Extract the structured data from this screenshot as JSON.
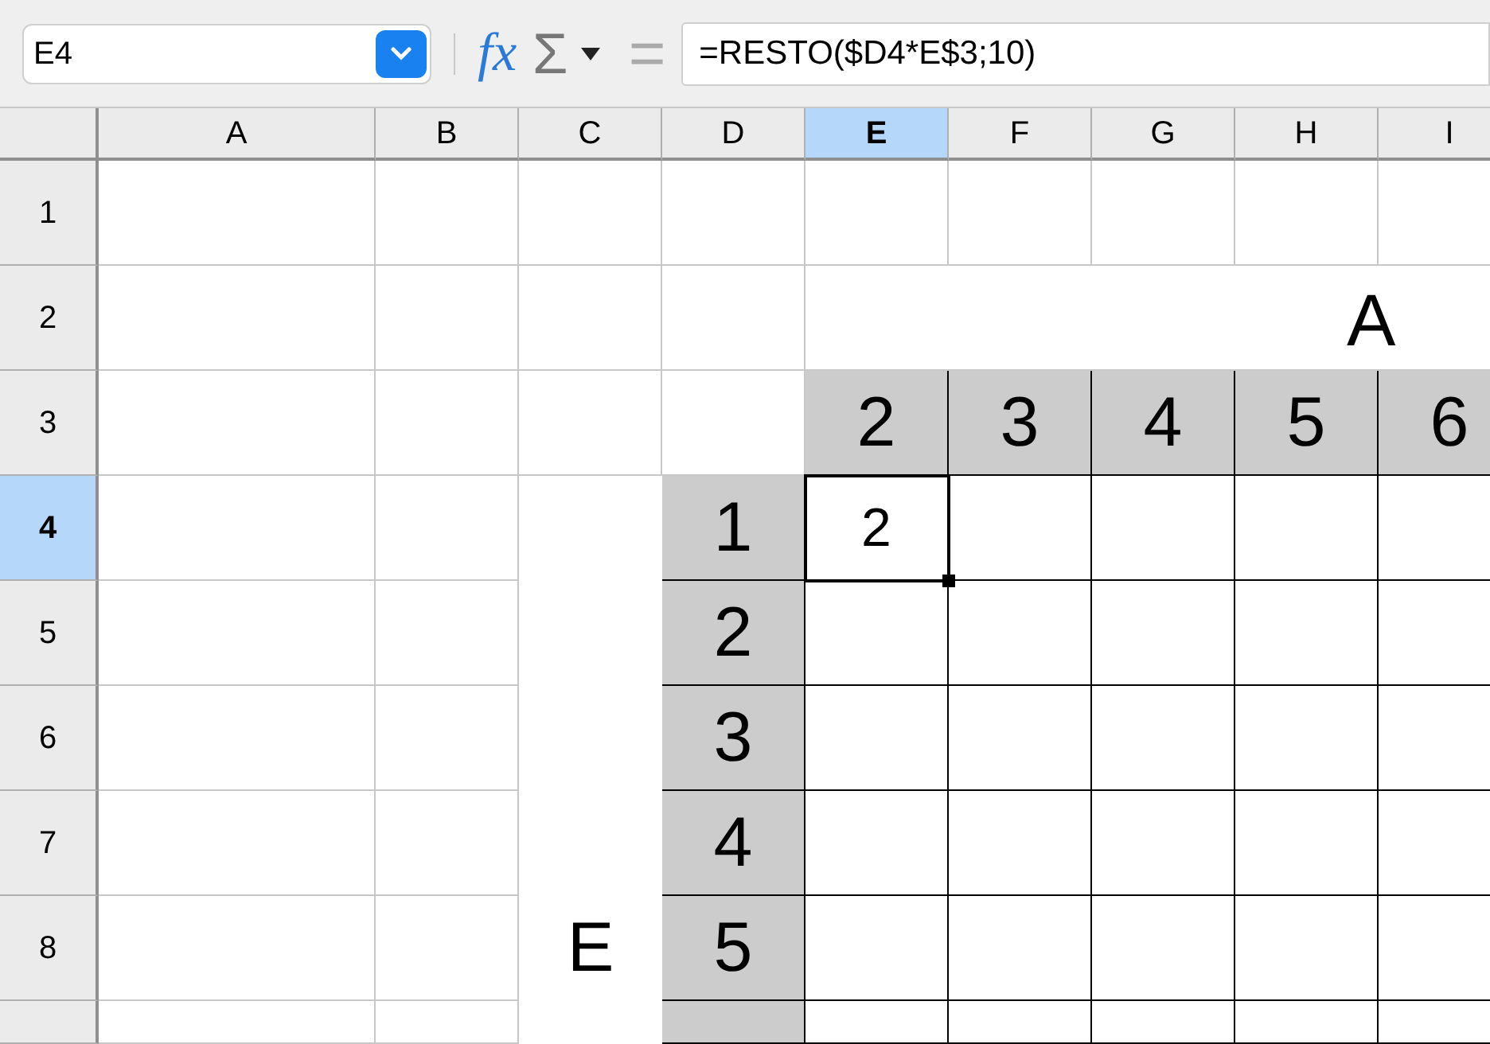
{
  "toolbar": {
    "name_box": "E4",
    "function_wizard": "fx",
    "sum": "Σ",
    "equals": "=",
    "formula": "=RESTO($D4*E$3;10)"
  },
  "columns": [
    {
      "label": "A",
      "selected": false
    },
    {
      "label": "B",
      "selected": false
    },
    {
      "label": "C",
      "selected": false
    },
    {
      "label": "D",
      "selected": false
    },
    {
      "label": "E",
      "selected": true
    },
    {
      "label": "F",
      "selected": false
    },
    {
      "label": "G",
      "selected": false
    },
    {
      "label": "H",
      "selected": false
    },
    {
      "label": "I",
      "selected": false
    }
  ],
  "rows": [
    {
      "label": "1",
      "selected": false,
      "cells": [
        {
          "kind": "grid"
        },
        {
          "kind": "grid"
        },
        {
          "kind": "grid"
        },
        {
          "kind": "grid"
        },
        {
          "kind": "grid"
        },
        {
          "kind": "grid"
        },
        {
          "kind": "grid"
        },
        {
          "kind": "grid"
        },
        {
          "kind": "grid"
        }
      ]
    },
    {
      "label": "2",
      "selected": false,
      "cells": [
        {
          "kind": "grid"
        },
        {
          "kind": "grid"
        },
        {
          "kind": "grid"
        },
        {
          "kind": "grid"
        },
        {
          "kind": "title",
          "text": "A"
        }
      ]
    },
    {
      "label": "3",
      "selected": false,
      "cells": [
        {
          "kind": "grid"
        },
        {
          "kind": "grid"
        },
        {
          "kind": "grid"
        },
        {
          "kind": "grid"
        },
        {
          "kind": "header",
          "text": "2"
        },
        {
          "kind": "header",
          "text": "3"
        },
        {
          "kind": "header",
          "text": "4"
        },
        {
          "kind": "header",
          "text": "5"
        },
        {
          "kind": "header",
          "text": "6"
        }
      ]
    },
    {
      "label": "4",
      "selected": true,
      "cells": [
        {
          "kind": "grid"
        },
        {
          "kind": "grid"
        },
        {
          "kind": "blank"
        },
        {
          "kind": "header",
          "text": "1"
        },
        {
          "kind": "table",
          "text": "2",
          "selected": true
        },
        {
          "kind": "table",
          "selected": false
        },
        {
          "kind": "table",
          "selected": false
        },
        {
          "kind": "table",
          "selected": false
        },
        {
          "kind": "table",
          "selected": false
        }
      ]
    },
    {
      "label": "5",
      "selected": false,
      "cells": [
        {
          "kind": "grid"
        },
        {
          "kind": "grid"
        },
        {
          "kind": "blank"
        },
        {
          "kind": "header",
          "text": "2"
        },
        {
          "kind": "table",
          "selected": false
        },
        {
          "kind": "table",
          "selected": false
        },
        {
          "kind": "table",
          "selected": false
        },
        {
          "kind": "table",
          "selected": false
        },
        {
          "kind": "table",
          "selected": false
        }
      ]
    },
    {
      "label": "6",
      "selected": false,
      "cells": [
        {
          "kind": "grid"
        },
        {
          "kind": "grid"
        },
        {
          "kind": "blank"
        },
        {
          "kind": "header",
          "text": "3"
        },
        {
          "kind": "table",
          "selected": false
        },
        {
          "kind": "table",
          "selected": false
        },
        {
          "kind": "table",
          "selected": false
        },
        {
          "kind": "table",
          "selected": false
        },
        {
          "kind": "table",
          "selected": false
        }
      ]
    },
    {
      "label": "7",
      "selected": false,
      "cells": [
        {
          "kind": "grid"
        },
        {
          "kind": "grid"
        },
        {
          "kind": "blank"
        },
        {
          "kind": "header",
          "text": "4"
        },
        {
          "kind": "table",
          "selected": false
        },
        {
          "kind": "table",
          "selected": false
        },
        {
          "kind": "table",
          "selected": false
        },
        {
          "kind": "table",
          "selected": false
        },
        {
          "kind": "table",
          "selected": false
        }
      ]
    },
    {
      "label": "8",
      "selected": false,
      "cells": [
        {
          "kind": "grid"
        },
        {
          "kind": "grid"
        },
        {
          "kind": "blank",
          "text": "E"
        },
        {
          "kind": "header",
          "text": "5"
        },
        {
          "kind": "table",
          "selected": false
        },
        {
          "kind": "table",
          "selected": false
        },
        {
          "kind": "table",
          "selected": false
        },
        {
          "kind": "table",
          "selected": false
        },
        {
          "kind": "table",
          "selected": false
        }
      ]
    },
    {
      "selected": false,
      "cells": [
        {
          "kind": "grid"
        },
        {
          "kind": "grid"
        },
        {
          "kind": "blank"
        },
        {
          "kind": "header"
        },
        {
          "kind": "table",
          "selected": false
        },
        {
          "kind": "table",
          "selected": false
        },
        {
          "kind": "table",
          "selected": false
        },
        {
          "kind": "table",
          "selected": false
        },
        {
          "kind": "table",
          "selected": false
        }
      ]
    }
  ]
}
